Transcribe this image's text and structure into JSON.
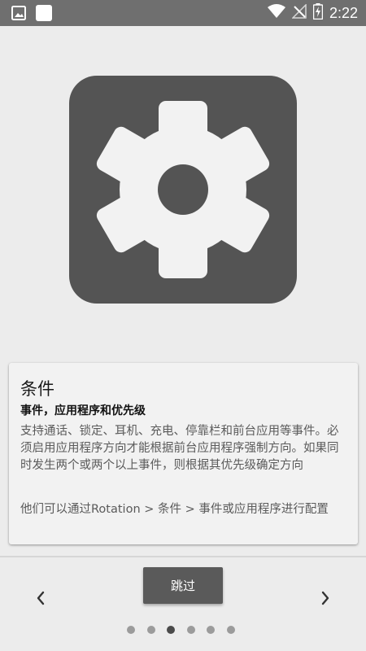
{
  "status_bar": {
    "time": "2:22",
    "left_icons": [
      "image-icon",
      "square-icon"
    ],
    "right_icons": [
      "wifi-icon",
      "no-signal-icon",
      "battery-charging-icon"
    ]
  },
  "hero": {
    "icon": "gear-icon"
  },
  "card": {
    "title": "条件",
    "subtitle": "事件，应用程序和优先级",
    "body": "支持通话、锁定、耳机、充电、停靠栏和前台应用等事件。必须启用应用程序方向才能根据前台应用程序强制方向。如果同时发生两个或两个以上事件，则根据其优先级确定方向",
    "note": "他们可以通过Rotation > 条件 > 事件或应用程序进行配置"
  },
  "nav": {
    "skip_label": "跳过",
    "prev_icon": "chevron-left-icon",
    "next_icon": "chevron-right-icon",
    "page_count": 6,
    "active_page": 3
  },
  "colors": {
    "status_bar": "#6f6f6f",
    "background": "#ececec",
    "icon_tile": "#545454",
    "button": "#5a5a5a",
    "active_dot": "#4a4a4a",
    "inactive_dot": "#9b9b9b"
  }
}
